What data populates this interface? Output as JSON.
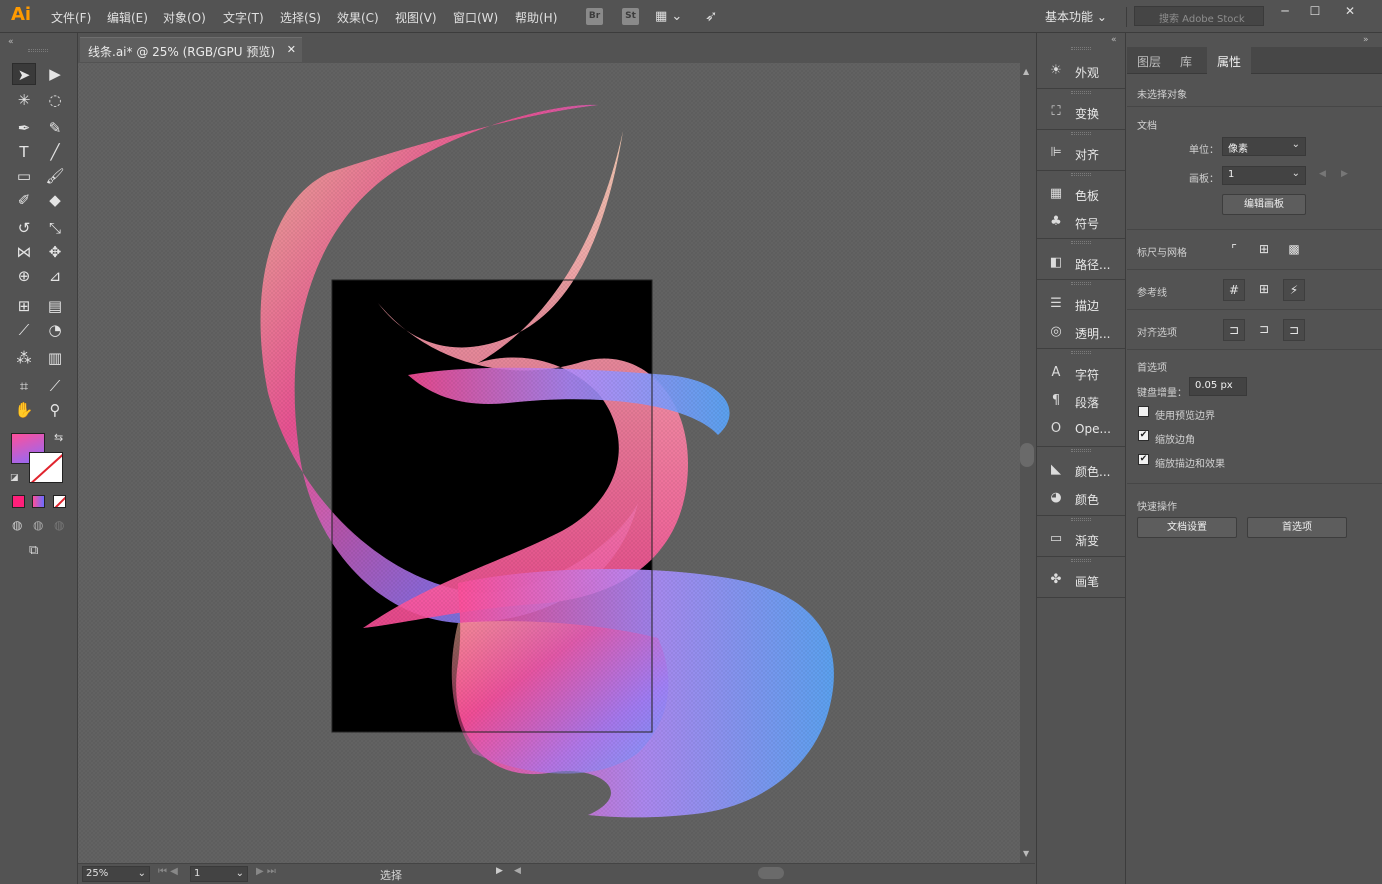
{
  "app": {
    "logo": "Ai"
  },
  "menu": [
    "文件(F)",
    "编辑(E)",
    "对象(O)",
    "文字(T)",
    "选择(S)",
    "效果(C)",
    "视图(V)",
    "窗口(W)",
    "帮助(H)"
  ],
  "menubar_icons": {
    "bridge": "Br",
    "stock": "St"
  },
  "workspace": {
    "label": "基本功能"
  },
  "stock_search": {
    "placeholder": "搜索 Adobe Stock"
  },
  "document": {
    "tab_title": "线条.ai* @ 25% (RGB/GPU 预览)"
  },
  "status": {
    "zoom": "25%",
    "artboard_number": "1",
    "tool_label": "选择"
  },
  "dock": {
    "items": [
      "外观",
      "变换",
      "对齐",
      "色板",
      "符号",
      "路径...",
      "描边",
      "透明...",
      "字符",
      "段落",
      "Ope...",
      "颜色...",
      "颜色",
      "渐变",
      "画笔"
    ]
  },
  "properties": {
    "tabs": [
      "图层",
      "库",
      "属性"
    ],
    "active_tab": "属性",
    "selection_status": "未选择对象",
    "document_section": "文档",
    "units_label": "单位：",
    "units_value": "像素",
    "artboard_label": "画板：",
    "artboard_value": "1",
    "edit_artboards_button": "编辑画板",
    "rulers_grids_label": "标尺与网格",
    "guides_label": "参考线",
    "snap_options_label": "对齐选项",
    "preferences_section": "首选项",
    "keyboard_increment_label": "键盘增量：",
    "keyboard_increment_value": "0.05 px",
    "use_preview_bounds": {
      "label": "使用预览边界",
      "checked": false
    },
    "scale_corners": {
      "label": "缩放边角",
      "checked": true
    },
    "scale_strokes_effects": {
      "label": "缩放描边和效果",
      "checked": true
    },
    "quick_actions_section": "快速操作",
    "document_setup_button": "文档设置",
    "preferences_button": "首选项"
  },
  "colors": {
    "accent_logo": "#ff9a00",
    "fill_gradient_start": "#ff4f9a",
    "fill_gradient_end": "#8a6cff"
  }
}
